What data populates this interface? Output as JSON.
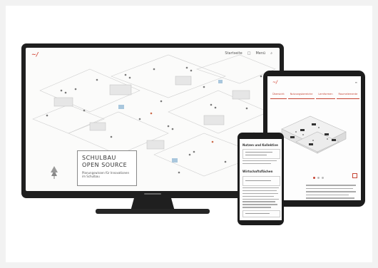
{
  "monitor": {
    "nav_links": [
      "Startseite",
      "Menü"
    ],
    "title_line1": "SCHULBAU",
    "title_line2": "OPEN SOURCE",
    "subtitle": "Planungswissen für Innovationen im Schulbau"
  },
  "tablet": {
    "tabs": [
      "Übersicht",
      "Nutzungsbereiche",
      "Lernformen",
      "Raumelemente"
    ]
  },
  "phone": {
    "heading": "Nutzen und Kollektive",
    "subheading": "Wirtschaftsflächen"
  },
  "colors": {
    "accent": "#c64433",
    "device": "#1f1f1f",
    "background": "#f2f2f2"
  }
}
